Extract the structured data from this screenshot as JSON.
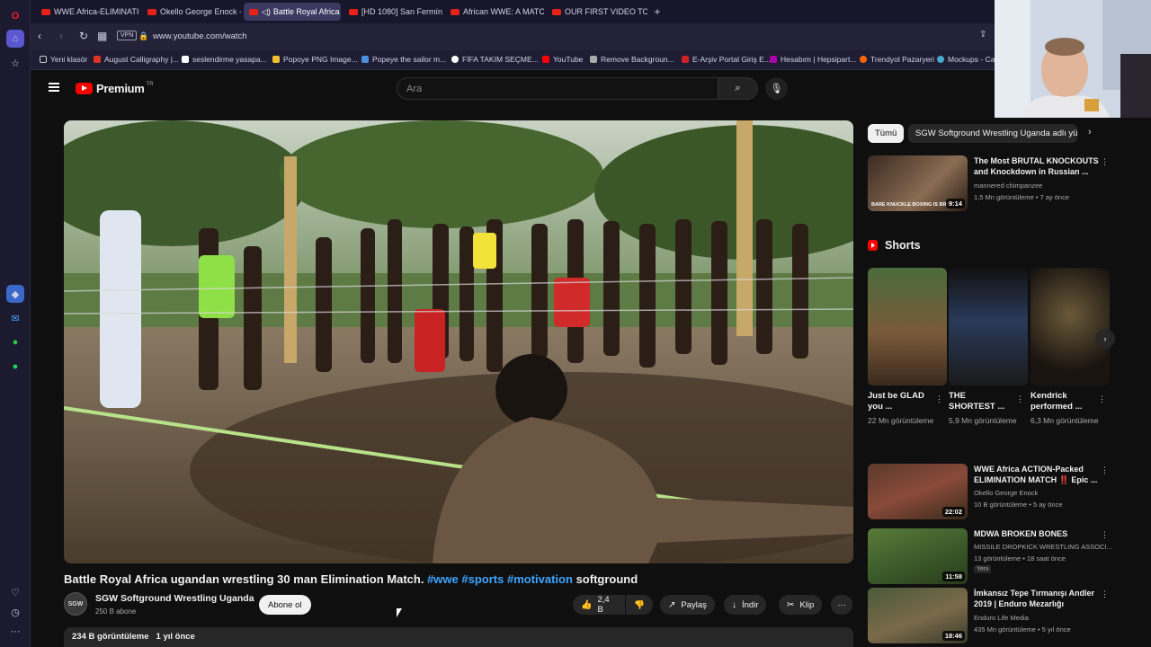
{
  "browser": {
    "tabs": [
      {
        "label": "WWE Africa-ELIMINATION"
      },
      {
        "label": "Okello George Enock - Yo"
      },
      {
        "label": "Battle Royal Africa ug"
      },
      {
        "label": "[HD 1080] San Fermín 20"
      },
      {
        "label": "African WWE: A MATCH T"
      },
      {
        "label": "OUR FIRST VIDEO TO GO"
      }
    ],
    "new_tab": "+",
    "vpn": "VPN",
    "url": "www.youtube.com/watch",
    "bookmarks": [
      {
        "label": "Yeni klasör"
      },
      {
        "label": "August Calligraphy |..."
      },
      {
        "label": "seslendirme yasapa..."
      },
      {
        "label": "Popoye PNG Image..."
      },
      {
        "label": "Popeye the sailor m..."
      },
      {
        "label": "FİFA TAKIM SEÇME..."
      },
      {
        "label": "YouTube"
      },
      {
        "label": "Remove Backgroun..."
      },
      {
        "label": "E-Arşiv Portal Giriş E..."
      },
      {
        "label": "Hesabım | Hepsipart..."
      },
      {
        "label": "Trendyol Pazaryeri"
      },
      {
        "label": "Mockups - Ca"
      }
    ]
  },
  "youtube": {
    "logo_text": "Premium",
    "logo_region": "TR",
    "search_placeholder": "Ara",
    "video": {
      "title_main": "Battle Royal Africa ugandan wrestling 30 man Elimination Match.",
      "hashtags": [
        "#wwe",
        "#sports",
        "#motivation"
      ],
      "title_end": "softground",
      "channel_avatar": "SGW",
      "channel": "SGW Softground Wrestling Uganda",
      "subscribers": "250 B abone",
      "subscribe": "Abone ol",
      "likes": "2,4 B",
      "share": "Paylaş",
      "download": "İndir",
      "clip": "Klip",
      "views": "234 B görüntüleme",
      "age": "1 yıl önce"
    },
    "chips": {
      "all": "Tümü",
      "channel": "SGW Softground Wrestling Uganda adlı yük"
    },
    "recommendations_top": {
      "title": "The Most BRUTAL KNOCKOUTS and Knockdown in Russian ...",
      "channel": "mannered chimpanzee",
      "meta": "1,5 Mn görüntüleme • 7 ay önce",
      "duration": "9:14",
      "thumb_caption": "BARE KNUCKLE BOXING IS BRU"
    },
    "shorts_title": "Shorts",
    "shorts": [
      {
        "title": "Just be GLAD you ...",
        "views": "22 Mn görüntüleme"
      },
      {
        "title": "THE SHORTEST ...",
        "views": "5,9 Mn görüntüleme"
      },
      {
        "title": "Kendrick performed ...",
        "views": "6,3 Mn görüntüleme"
      }
    ],
    "recommendations": [
      {
        "title": "WWE Africa ACTION-Packed ELIMINATION MATCH ‼️ Epic ...",
        "channel": "Okello George Enock",
        "meta": "10 B görüntüleme • 5 ay önce",
        "duration": "22:02"
      },
      {
        "title": "MDWA BROKEN BONES",
        "channel": "MISSILE DROPKICK WRESTLING ASSOCI...",
        "meta": "13 görüntüleme • 18 saat önce",
        "badge": "Yeni",
        "duration": "11:58"
      },
      {
        "title": "İmkansız Tepe Tırmanışı Andler 2019 | Enduro Mezarlığı",
        "channel": "Enduro Life Media",
        "meta": "435 Mn görüntüleme • 5 yıl önce",
        "duration": "18:46"
      }
    ]
  },
  "colors": {
    "accent": "#3ea6ff",
    "brand": "#ff0000",
    "bg": "#0f0f0f"
  }
}
